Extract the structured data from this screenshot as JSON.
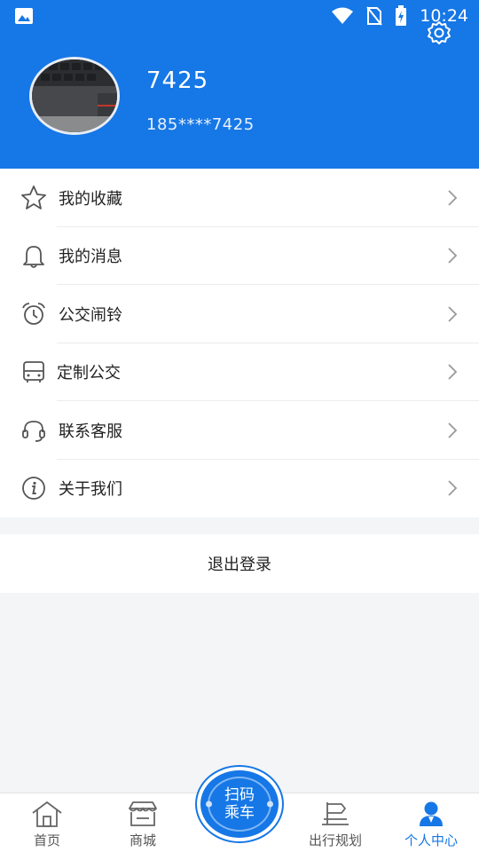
{
  "status_bar": {
    "time": "10:24"
  },
  "profile": {
    "name": "7425",
    "phone": "185****7425"
  },
  "menu": [
    {
      "label": "我的收藏",
      "icon": "star-icon"
    },
    {
      "label": "我的消息",
      "icon": "bell-icon"
    },
    {
      "label": "公交闹铃",
      "icon": "alarm-clock-icon"
    },
    {
      "label": "定制公交",
      "icon": "bus-icon"
    },
    {
      "label": "联系客服",
      "icon": "headset-icon"
    },
    {
      "label": "关于我们",
      "icon": "info-icon"
    }
  ],
  "logout_label": "退出登录",
  "tabbar": {
    "home": "首页",
    "mall": "商城",
    "scan_line1": "扫码",
    "scan_line2": "乘车",
    "route": "出行规划",
    "profile": "个人中心",
    "active_tab": "个人中心"
  },
  "colors": {
    "accent": "#1677e6",
    "background": "#f4f5f7"
  }
}
